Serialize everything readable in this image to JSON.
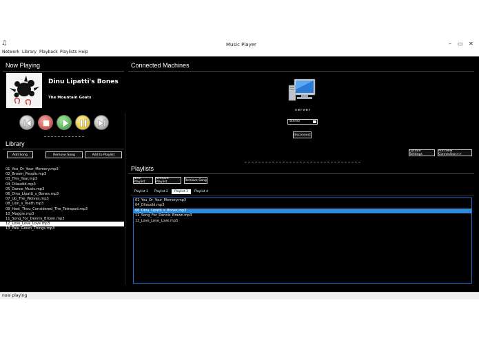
{
  "window": {
    "title": "Music Player",
    "app_icon": "music-note-icon",
    "controls": {
      "minimize": "–",
      "maximize": "▭",
      "close": "✕"
    }
  },
  "menu": {
    "items": [
      "Network",
      "Library",
      "Playback",
      "Playlists",
      "Help"
    ]
  },
  "now_playing": {
    "heading": "Now Playing",
    "song_title": "Dinu Lipatti's Bones",
    "artist": "The Mountain Goats"
  },
  "transport": {
    "buttons": [
      {
        "name": "previous",
        "icon": "previous-icon",
        "color": "#c9c9c9"
      },
      {
        "name": "stop",
        "icon": "stop-icon",
        "color": "#e34b4b"
      },
      {
        "name": "play",
        "icon": "play-icon",
        "color": "#3fb44a"
      },
      {
        "name": "pause",
        "icon": "pause-icon",
        "color": "#e6c21d"
      },
      {
        "name": "next",
        "icon": "next-icon",
        "color": "#c9c9c9"
      }
    ]
  },
  "library": {
    "heading": "Library",
    "add_song_label": "Add Song",
    "remove_song_label": "Remove Song",
    "add_to_playlist_label": "Add to Playlist",
    "songs": [
      "01_You_Or_Your_Memory.mp3",
      "02_Broom_People.mp3",
      "03_This_Year.mp3",
      "04_Dilaudid.mp3",
      "05_Dance_Music.mp3",
      "06_Dinu_Lipatti_s_Bones.mp3",
      "07_Up_The_Wolves.mp3",
      "08_Lion_s_Teeth.mp3",
      "09_Hast_Thou_Considered_The_Tetrapod.mp3",
      "10_Maggie.mp3",
      "11_Song_For_Dennis_Brown.mp3",
      "12_Love_Love_Love.mp3",
      "13_Pale_Green_Things.mp3"
    ],
    "selected_index": 11
  },
  "connected": {
    "heading": "Connected Machines",
    "machine_name": "server",
    "machine_icon": "computer-icon",
    "audio_mode": "Stereo",
    "disconnect_label": "disconnect",
    "update_settings_label": "Update Settings",
    "add_connection_label": "Add New Connection>>"
  },
  "playlists": {
    "heading": "Playlists",
    "new_playlist_label": "New Playlist",
    "remove_playlist_label": "Remove Playlist",
    "remove_song_label": "Remove Song",
    "tabs": [
      "Playlist 1",
      "Playlist 2",
      "Playlist 3",
      "Playlist 4"
    ],
    "active_tab": 2,
    "songs": [
      "01_You_Or_Your_Memory.mp3",
      "04_Dilaudid.mp3",
      "06_Dinu_Lipatti_s_Bones.mp3",
      "11_Song_For_Dennis_Brown.mp3",
      "12_Love_Love_Love.mp3"
    ],
    "selected_index": 2
  },
  "status": {
    "text": "now playing"
  }
}
